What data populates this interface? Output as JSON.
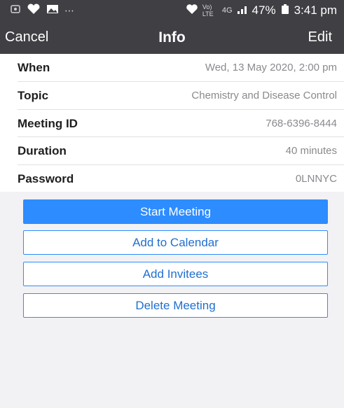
{
  "status_bar": {
    "left_icons": [
      "notification-icon",
      "heart-app-icon",
      "image-icon",
      "more-dots-icon"
    ],
    "network": "Vo) LTE",
    "network_type": "4G",
    "battery": "47%",
    "time": "3:41 pm"
  },
  "nav": {
    "cancel_label": "Cancel",
    "title": "Info",
    "edit_label": "Edit"
  },
  "details": [
    {
      "label": "When",
      "value": "Wed, 13 May 2020, 2:00 pm"
    },
    {
      "label": "Topic",
      "value": "Chemistry and Disease Control"
    },
    {
      "label": "Meeting ID",
      "value": "768-6396-8444"
    },
    {
      "label": "Duration",
      "value": "40 minutes"
    },
    {
      "label": "Password",
      "value": "0LNNYC"
    }
  ],
  "actions": {
    "start": "Start Meeting",
    "calendar": "Add to Calendar",
    "invitees": "Add Invitees",
    "delete": "Delete Meeting"
  },
  "colors": {
    "header_bg": "#3f3f44",
    "accent": "#2d8cff",
    "button_text": "#1f6fd1",
    "page_bg": "#f2f2f5"
  }
}
